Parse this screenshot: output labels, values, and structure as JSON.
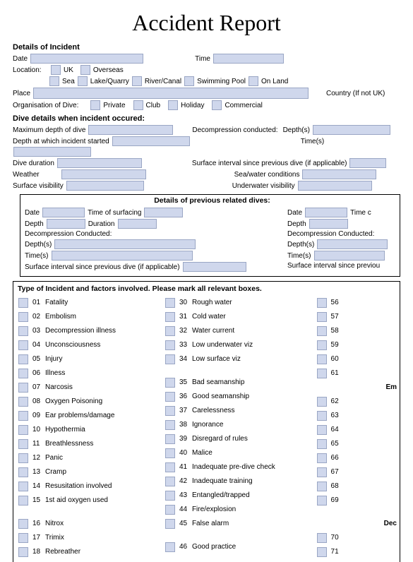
{
  "title": "Accident Report",
  "sections": {
    "details": {
      "heading": "Details of Incident",
      "date": "Date",
      "time": "Time",
      "location": "Location:",
      "uk": "UK",
      "overseas": "Overseas",
      "sea": "Sea",
      "lakequarry": "Lake/Quarry",
      "rivercanal": "River/Canal",
      "swimmingpool": "Swimming Pool",
      "onland": "On Land",
      "place": "Place",
      "country": "Country (If not UK)",
      "orgdive": "Organisation of Dive:",
      "private": "Private",
      "club": "Club",
      "holiday": "Holiday",
      "commercial": "Commercial"
    },
    "divedetails": {
      "heading": "Dive details when incident occured:",
      "maxdepth": "Maximum depth of dive",
      "depthstart": "Depth at which incident started",
      "diveduration": "Dive duration",
      "weather": "Weather",
      "surfviz": "Surface visibility",
      "decomp": "Decompression conducted:",
      "depths": "Depth(s)",
      "times": "Time(s)",
      "surfint": "Surface interval since previous dive (if applicable)",
      "seacond": "Sea/water conditions",
      "underviz": "Underwater visibility"
    },
    "prev": {
      "heading": "Details of previous related dives:",
      "date": "Date",
      "timeofsurf": "Time of surfacing",
      "depth": "Depth",
      "duration": "Duration",
      "decomp": "Decompression Conducted:",
      "depths": "Depth(s)",
      "times": "Time(s)",
      "surfint": "Surface interval since previous dive (if applicable)",
      "date2": "Date",
      "timec": "Time c",
      "depth2": "Depth",
      "decomp2": "Decompression Conducted:",
      "depths2": "Depth(s)",
      "times2": "Time(s)",
      "surfint2": "Surface interval since previou"
    },
    "type": {
      "heading": "Type of Incident and factors involved. Please mark all relevant boxes.",
      "col1": [
        {
          "n": "01",
          "l": "Fatality"
        },
        {
          "n": "02",
          "l": "Embolism"
        },
        {
          "n": "03",
          "l": "Decompression illness"
        },
        {
          "n": "04",
          "l": "Unconsciousness"
        },
        {
          "n": "05",
          "l": "Injury"
        },
        {
          "n": "06",
          "l": "Illness"
        },
        {
          "n": "07",
          "l": "Narcosis"
        },
        {
          "n": "08",
          "l": "Oxygen Poisoning"
        },
        {
          "n": "09",
          "l": "Ear problems/damage"
        },
        {
          "n": "10",
          "l": "Hypothermia"
        },
        {
          "n": "11",
          "l": "Breathlessness"
        },
        {
          "n": "12",
          "l": "Panic"
        },
        {
          "n": "13",
          "l": "Cramp"
        },
        {
          "n": "14",
          "l": "Resusitation involved"
        },
        {
          "n": "15",
          "l": "1st aid oxygen used"
        },
        {
          "n": "",
          "l": ""
        },
        {
          "n": "16",
          "l": "Nitrox"
        },
        {
          "n": "17",
          "l": "Trimix"
        },
        {
          "n": "18",
          "l": "Rebreather"
        }
      ],
      "col2": [
        {
          "n": "30",
          "l": "Rough water"
        },
        {
          "n": "31",
          "l": "Cold water"
        },
        {
          "n": "32",
          "l": "Water current"
        },
        {
          "n": "33",
          "l": "Low underwater viz"
        },
        {
          "n": "34",
          "l": "Low surface viz"
        },
        {
          "n": "",
          "l": ""
        },
        {
          "n": "35",
          "l": "Bad seamanship"
        },
        {
          "n": "36",
          "l": "Good seamanship"
        },
        {
          "n": "37",
          "l": "Carelessness"
        },
        {
          "n": "38",
          "l": "Ignorance"
        },
        {
          "n": "39",
          "l": "Disregard of rules"
        },
        {
          "n": "40",
          "l": "Malice"
        },
        {
          "n": "41",
          "l": "Inadequate pre-dive check"
        },
        {
          "n": "42",
          "l": "Inadequate training"
        },
        {
          "n": "43",
          "l": "Entangled/trapped"
        },
        {
          "n": "44",
          "l": "Fire/explosion"
        },
        {
          "n": "45",
          "l": "False alarm"
        },
        {
          "n": "",
          "l": ""
        },
        {
          "n": "46",
          "l": "Good practice"
        }
      ],
      "col3": [
        {
          "n": "56",
          "l": ""
        },
        {
          "n": "57",
          "l": ""
        },
        {
          "n": "58",
          "l": ""
        },
        {
          "n": "59",
          "l": ""
        },
        {
          "n": "60",
          "l": ""
        },
        {
          "n": "61",
          "l": ""
        },
        {
          "n": "",
          "l": "",
          "h": "Em"
        },
        {
          "n": "62",
          "l": ""
        },
        {
          "n": "63",
          "l": ""
        },
        {
          "n": "64",
          "l": ""
        },
        {
          "n": "65",
          "l": ""
        },
        {
          "n": "66",
          "l": ""
        },
        {
          "n": "67",
          "l": ""
        },
        {
          "n": "68",
          "l": ""
        },
        {
          "n": "69",
          "l": ""
        },
        {
          "n": "",
          "l": ""
        },
        {
          "n": "",
          "l": "",
          "h": "Dec"
        },
        {
          "n": "70",
          "l": ""
        },
        {
          "n": "71",
          "l": ""
        }
      ]
    }
  }
}
